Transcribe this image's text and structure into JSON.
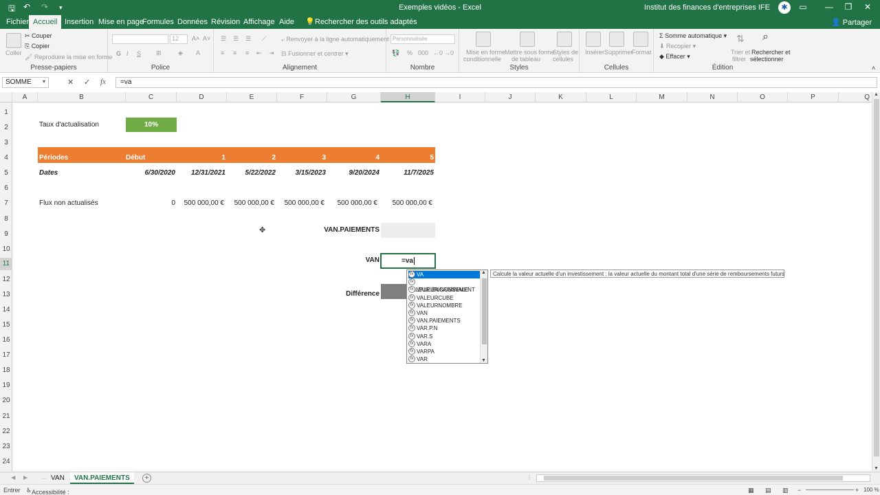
{
  "titlebar": {
    "doc_title": "Exemples vidéos  -  Excel",
    "user": "Institut des finances d'entreprises IFE",
    "avatar_icon": "ife-avatar-icon"
  },
  "tabs": [
    "Fichier",
    "Accueil",
    "Insertion",
    "Mise en page",
    "Formules",
    "Données",
    "Révision",
    "Affichage",
    "Aide",
    "Rechercher des outils adaptés"
  ],
  "active_tab": "Accueil",
  "share": "Partager",
  "ribbon": {
    "clipboard": {
      "label": "Presse-papiers",
      "paste": "Coller",
      "cut": "Couper",
      "copy": "Copier",
      "format_painter": "Reproduire la mise en forme"
    },
    "font": {
      "label": "Police",
      "size": "12",
      "bold": "G",
      "italic": "I",
      "underline": "S"
    },
    "alignment": {
      "label": "Alignement",
      "wrap": "Renvoyer à la ligne automatiquement",
      "merge": "Fusionner et centrer"
    },
    "number": {
      "label": "Nombre",
      "format": "Personnalisée"
    },
    "styles": {
      "label": "Styles",
      "conditional1": "Mise en forme",
      "conditional2": "conditionnelle",
      "table1": "Mettre sous forme",
      "table2": "de tableau",
      "cell1": "Styles de",
      "cell2": "cellules"
    },
    "cells": {
      "label": "Cellules",
      "insert": "Insérer",
      "delete": "Supprimer",
      "format": "Format"
    },
    "editing": {
      "label": "Édition",
      "autosum": "Somme automatique",
      "fill": "Recopier",
      "clear": "Effacer",
      "sort1": "Trier et",
      "sort2": "filtrer",
      "find1": "Rechercher et",
      "find2": "sélectionner"
    }
  },
  "formula_bar": {
    "name_box": "SOMME",
    "formula": "=va"
  },
  "columns": [
    "A",
    "B",
    "C",
    "D",
    "E",
    "F",
    "G",
    "H",
    "I",
    "J",
    "K",
    "L",
    "M",
    "N",
    "O",
    "P",
    "Q"
  ],
  "rows": [
    "1",
    "2",
    "3",
    "4",
    "5",
    "6",
    "7",
    "8",
    "9",
    "10",
    "11",
    "12",
    "13",
    "14",
    "15",
    "16",
    "17",
    "18",
    "19",
    "20",
    "21",
    "22",
    "23",
    "24"
  ],
  "sheet": {
    "discount_rate_label": "Taux d'actualisation",
    "discount_rate_value": "10%",
    "periods_label": "Périodes",
    "periods": [
      "Début",
      "1",
      "2",
      "3",
      "4",
      "5"
    ],
    "dates_label": "Dates",
    "dates": [
      "6/30/2020",
      "12/31/2021",
      "5/22/2022",
      "3/15/2023",
      "9/20/2024",
      "11/7/2025"
    ],
    "flows_label": "Flux non actualisés",
    "flows": [
      "0",
      "500 000,00 €",
      "500 000,00 €",
      "500 000,00 €",
      "500 000,00 €",
      "500 000,00 €"
    ],
    "vanp_label": "VAN.PAIEMENTS",
    "van_label": "VAN",
    "active_cell_value": "=va",
    "diff_label": "Différence"
  },
  "autocomplete": {
    "items": [
      "VA",
      "VALEUR.ENCAISSEMENT",
      "VALEUR.NOMINALE",
      "VALEURCUBE",
      "VALEURNOMBRE",
      "VAN",
      "VAN.PAIEMENTS",
      "VAR.P.N",
      "VAR.S",
      "VARA",
      "VARPA",
      "VAR"
    ],
    "tooltip": "Calcule la valeur actuelle d'un investissement : la valeur actuelle du montant total d'une série de remboursements futurs"
  },
  "sheet_tabs": [
    "VAN",
    "VAN.PAIEMENTS"
  ],
  "active_sheet": "VAN.PAIEMENTS",
  "status": {
    "mode": "Entrer",
    "accessibility": "Accessibilité : consultez nos recommandations",
    "zoom": "100 %"
  }
}
